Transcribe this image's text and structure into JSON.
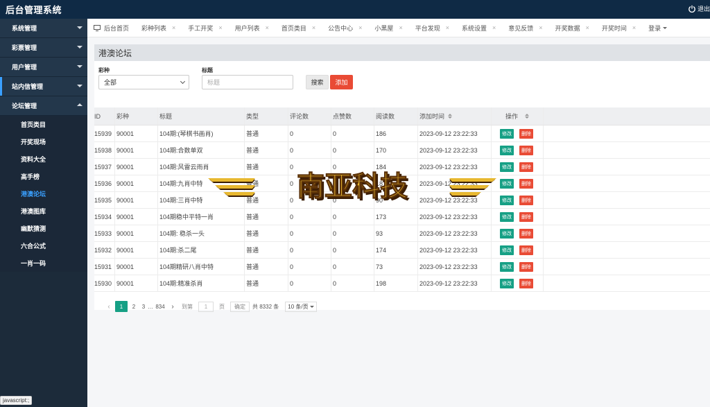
{
  "app": {
    "title": "后台管理系统",
    "logout_label": "退出"
  },
  "sidebar": {
    "groups": [
      {
        "label": "系统管理",
        "expanded": false
      },
      {
        "label": "彩票管理",
        "expanded": false
      },
      {
        "label": "用户管理",
        "expanded": false
      },
      {
        "label": "站内信管理",
        "expanded": false
      },
      {
        "label": "论坛管理",
        "expanded": true
      }
    ],
    "forum_items": [
      {
        "label": "首页类目"
      },
      {
        "label": "开奖现场"
      },
      {
        "label": "资料大全"
      },
      {
        "label": "高手榜"
      },
      {
        "label": "港澳论坛",
        "active": true
      },
      {
        "label": "港澳图库"
      },
      {
        "label": "幽默猜测"
      },
      {
        "label": "六合公式"
      },
      {
        "label": "一肖一码"
      }
    ]
  },
  "tabs": [
    {
      "label": "后台首页",
      "icon": "home-icon"
    },
    {
      "label": "彩种列表"
    },
    {
      "label": "手工开奖"
    },
    {
      "label": "用户列表"
    },
    {
      "label": "首页类目"
    },
    {
      "label": "公告中心"
    },
    {
      "label": "小黑屋"
    },
    {
      "label": "平台发现"
    },
    {
      "label": "系统设置"
    },
    {
      "label": "意见反馈"
    },
    {
      "label": "开奖数据"
    },
    {
      "label": "开奖时间"
    },
    {
      "label": "登录"
    }
  ],
  "tab_close_glyph": "×",
  "panel": {
    "title": "港澳论坛"
  },
  "filters": {
    "lottery_label": "彩种",
    "lottery_value": "全部",
    "title_label": "标题",
    "title_placeholder": "标题",
    "search_label": "搜索",
    "add_label": "添加"
  },
  "table": {
    "columns": [
      "ID",
      "彩种",
      "标题",
      "类型",
      "评论数",
      "点赞数",
      "阅读数",
      "添加时间",
      "操作"
    ],
    "edit_label": "修改",
    "delete_label": "删除",
    "rows": [
      {
        "id": "15939",
        "lottery": "90001",
        "title": "104期:(琴棋书画肖)",
        "type": "普通",
        "comments": "0",
        "likes": "0",
        "reads": "186",
        "time": "2023-09-12 23:22:33"
      },
      {
        "id": "15938",
        "lottery": "90001",
        "title": "104期:合数单双",
        "type": "普通",
        "comments": "0",
        "likes": "0",
        "reads": "170",
        "time": "2023-09-12 23:22:33"
      },
      {
        "id": "15937",
        "lottery": "90001",
        "title": "104期:风雷云雨肖",
        "type": "普通",
        "comments": "0",
        "likes": "0",
        "reads": "184",
        "time": "2023-09-12 23:22:33"
      },
      {
        "id": "15936",
        "lottery": "90001",
        "title": "104期:九肖中特",
        "type": "普通",
        "comments": "0",
        "likes": "0",
        "reads": "18",
        "time": "2023-09-12 23:22:33"
      },
      {
        "id": "15935",
        "lottery": "90001",
        "title": "104期:三肖中特",
        "type": "普通",
        "comments": "0",
        "likes": "0",
        "reads": "90",
        "time": "2023-09-12 23:22:33"
      },
      {
        "id": "15934",
        "lottery": "90001",
        "title": "104期稳中平特一肖",
        "type": "普通",
        "comments": "0",
        "likes": "0",
        "reads": "173",
        "time": "2023-09-12 23:22:33"
      },
      {
        "id": "15933",
        "lottery": "90001",
        "title": "104期: 稳杀一头",
        "type": "普通",
        "comments": "0",
        "likes": "0",
        "reads": "93",
        "time": "2023-09-12 23:22:33"
      },
      {
        "id": "15932",
        "lottery": "90001",
        "title": "104期:杀二尾",
        "type": "普通",
        "comments": "0",
        "likes": "0",
        "reads": "174",
        "time": "2023-09-12 23:22:33"
      },
      {
        "id": "15931",
        "lottery": "90001",
        "title": "104期精研八肖中特",
        "type": "普通",
        "comments": "0",
        "likes": "0",
        "reads": "73",
        "time": "2023-09-12 23:22:33"
      },
      {
        "id": "15930",
        "lottery": "90001",
        "title": "104期:精准杀肖",
        "type": "普通",
        "comments": "0",
        "likes": "0",
        "reads": "198",
        "time": "2023-09-12 23:22:33"
      }
    ]
  },
  "pagination": {
    "prev": "‹",
    "next": "›",
    "current": "1",
    "page2": "2",
    "page3": "3",
    "ellipsis": "…",
    "last": "834",
    "goto_label": "到第",
    "goto_value": "1",
    "page_suffix": "页",
    "confirm_label": "确定",
    "total_text": "共 8332 条",
    "page_size": "10 条/页"
  },
  "watermark": {
    "text": "南亚科技",
    "colors": {
      "gold": "#e8b830",
      "dark": "#3a1d05"
    }
  },
  "status_tip": "javascript:;",
  "colors": {
    "topbar": "#0f2a45",
    "sidebar": "#1c2b3a",
    "accent_blue": "#3aa0ff",
    "edit_green": "#16a085",
    "danger_red": "#e94b35"
  }
}
